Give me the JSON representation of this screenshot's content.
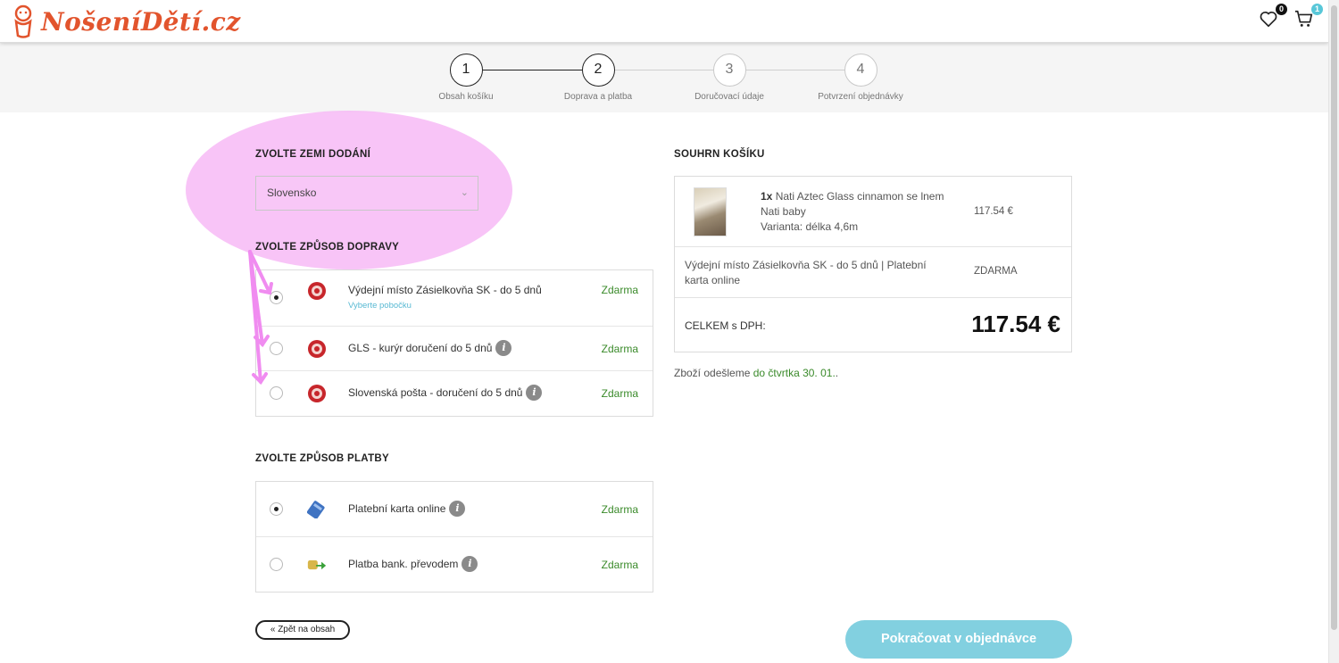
{
  "header": {
    "logo_text": "NošeníDětí.cz",
    "wishlist_count": "0",
    "cart_count": "1"
  },
  "stepper": {
    "steps": [
      {
        "number": "1",
        "label": "Obsah košíku"
      },
      {
        "number": "2",
        "label": "Doprava a platba"
      },
      {
        "number": "3",
        "label": "Doručovací údaje"
      },
      {
        "number": "4",
        "label": "Potvrzení objednávky"
      }
    ]
  },
  "country": {
    "title": "ZVOLTE ZEMI DODÁNÍ",
    "selected": "Slovensko"
  },
  "shipping": {
    "title": "ZVOLTE ZPŮSOB DOPRAVY",
    "options": [
      {
        "label": "Výdejní místo Zásielkovňa SK - do 5 dnů",
        "sub": "Vyberte pobočku",
        "price": "Zdarma",
        "selected": true
      },
      {
        "label": "GLS - kurýr doručení do 5 dnů",
        "price": "Zdarma",
        "selected": false
      },
      {
        "label": "Slovenská pošta - doručení do 5 dnů",
        "price": "Zdarma",
        "selected": false
      }
    ]
  },
  "payment": {
    "title": "ZVOLTE ZPŮSOB PLATBY",
    "options": [
      {
        "label": "Platební karta online",
        "price": "Zdarma",
        "selected": true
      },
      {
        "label": "Platba bank. převodem",
        "price": "Zdarma",
        "selected": false
      }
    ]
  },
  "summary": {
    "title": "SOUHRN KOŠÍKU",
    "product": {
      "qty": "1x",
      "name": "Nati Aztec Glass cinnamon se lnem",
      "brand": "Nati baby",
      "variant": "Varianta: délka 4,6m",
      "price": "117.54 €"
    },
    "shipping_line": "Výdejní místo Zásielkovňa SK - do 5 dnů | Platební karta online",
    "shipping_price": "ZDARMA",
    "total_label": "CELKEM s DPH:",
    "total_value": "117.54 €",
    "delivery_prefix": "Zboží odešleme",
    "delivery_date": "do čtvrtka 30. 01.",
    "delivery_suffix": "."
  },
  "actions": {
    "back": "« Zpět na obsah",
    "continue": "Pokračovat v objednávce"
  },
  "colors": {
    "brand": "#e2542d",
    "accent": "#82d0e0",
    "price_green": "#3a8a2a",
    "annotation_pink": "#f6b4f5"
  }
}
